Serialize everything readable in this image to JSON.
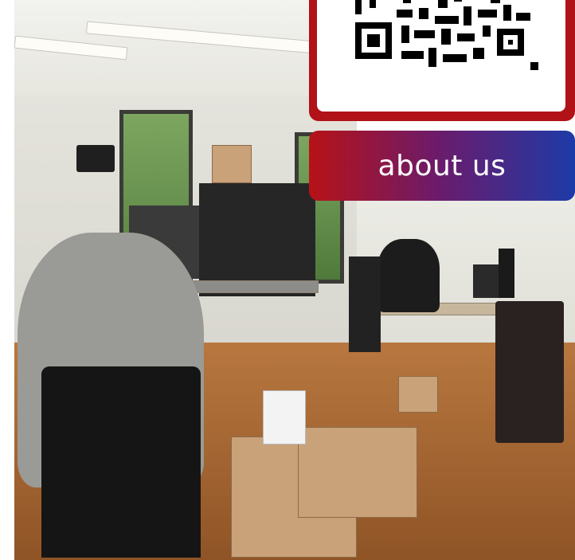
{
  "cta": {
    "about_label": "about us"
  },
  "colors": {
    "accent_red": "#b01217",
    "accent_blue": "#1d3aa8"
  }
}
